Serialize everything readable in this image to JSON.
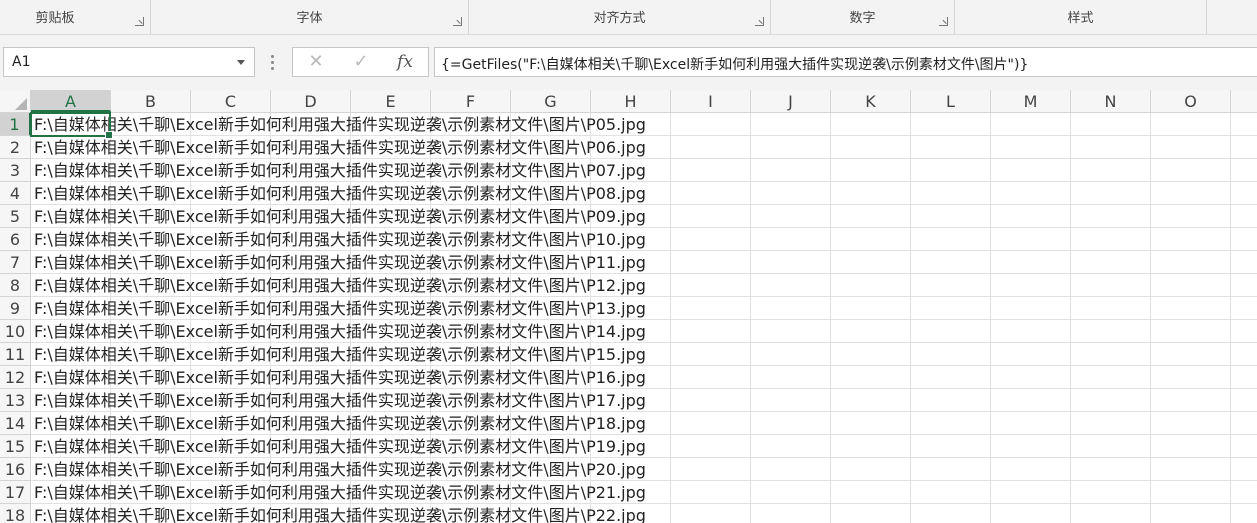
{
  "ribbon": {
    "groups": [
      {
        "label": "剪贴板"
      },
      {
        "label": "字体"
      },
      {
        "label": "对齐方式"
      },
      {
        "label": "数字"
      },
      {
        "label": "样式"
      }
    ]
  },
  "formula_bar": {
    "name_box": "A1",
    "cancel_glyph": "✕",
    "enter_glyph": "✓",
    "fx_label": "fx",
    "formula": "{=GetFiles(\"F:\\自媒体相关\\千聊\\Excel新手如何利用强大插件实现逆袭\\示例素材文件\\图片\")}"
  },
  "sheet": {
    "columns": [
      "A",
      "B",
      "C",
      "D",
      "E",
      "F",
      "G",
      "H",
      "I",
      "J",
      "K",
      "L",
      "M",
      "N",
      "O"
    ],
    "selected_cell": "A1",
    "rows": [
      {
        "num": "1",
        "a": "F:\\自媒体相关\\千聊\\Excel新手如何利用强大插件实现逆袭\\示例素材文件\\图片\\P05.jpg"
      },
      {
        "num": "2",
        "a": "F:\\自媒体相关\\千聊\\Excel新手如何利用强大插件实现逆袭\\示例素材文件\\图片\\P06.jpg"
      },
      {
        "num": "3",
        "a": "F:\\自媒体相关\\千聊\\Excel新手如何利用强大插件实现逆袭\\示例素材文件\\图片\\P07.jpg"
      },
      {
        "num": "4",
        "a": "F:\\自媒体相关\\千聊\\Excel新手如何利用强大插件实现逆袭\\示例素材文件\\图片\\P08.jpg"
      },
      {
        "num": "5",
        "a": "F:\\自媒体相关\\千聊\\Excel新手如何利用强大插件实现逆袭\\示例素材文件\\图片\\P09.jpg"
      },
      {
        "num": "6",
        "a": "F:\\自媒体相关\\千聊\\Excel新手如何利用强大插件实现逆袭\\示例素材文件\\图片\\P10.jpg"
      },
      {
        "num": "7",
        "a": "F:\\自媒体相关\\千聊\\Excel新手如何利用强大插件实现逆袭\\示例素材文件\\图片\\P11.jpg"
      },
      {
        "num": "8",
        "a": "F:\\自媒体相关\\千聊\\Excel新手如何利用强大插件实现逆袭\\示例素材文件\\图片\\P12.jpg"
      },
      {
        "num": "9",
        "a": "F:\\自媒体相关\\千聊\\Excel新手如何利用强大插件实现逆袭\\示例素材文件\\图片\\P13.jpg"
      },
      {
        "num": "10",
        "a": "F:\\自媒体相关\\千聊\\Excel新手如何利用强大插件实现逆袭\\示例素材文件\\图片\\P14.jpg"
      },
      {
        "num": "11",
        "a": "F:\\自媒体相关\\千聊\\Excel新手如何利用强大插件实现逆袭\\示例素材文件\\图片\\P15.jpg"
      },
      {
        "num": "12",
        "a": "F:\\自媒体相关\\千聊\\Excel新手如何利用强大插件实现逆袭\\示例素材文件\\图片\\P16.jpg"
      },
      {
        "num": "13",
        "a": "F:\\自媒体相关\\千聊\\Excel新手如何利用强大插件实现逆袭\\示例素材文件\\图片\\P17.jpg"
      },
      {
        "num": "14",
        "a": "F:\\自媒体相关\\千聊\\Excel新手如何利用强大插件实现逆袭\\示例素材文件\\图片\\P18.jpg"
      },
      {
        "num": "15",
        "a": "F:\\自媒体相关\\千聊\\Excel新手如何利用强大插件实现逆袭\\示例素材文件\\图片\\P19.jpg"
      },
      {
        "num": "16",
        "a": "F:\\自媒体相关\\千聊\\Excel新手如何利用强大插件实现逆袭\\示例素材文件\\图片\\P20.jpg"
      },
      {
        "num": "17",
        "a": "F:\\自媒体相关\\千聊\\Excel新手如何利用强大插件实现逆袭\\示例素材文件\\图片\\P21.jpg"
      },
      {
        "num": "18",
        "a": "F:\\自媒体相关\\千聊\\Excel新手如何利用强大插件实现逆袭\\示例素材文件\\图片\\P22.jpg"
      }
    ]
  },
  "colors": {
    "accent": "#217346",
    "ribbon_bg": "#f3f3f3",
    "gridline": "#e1e1e1"
  }
}
